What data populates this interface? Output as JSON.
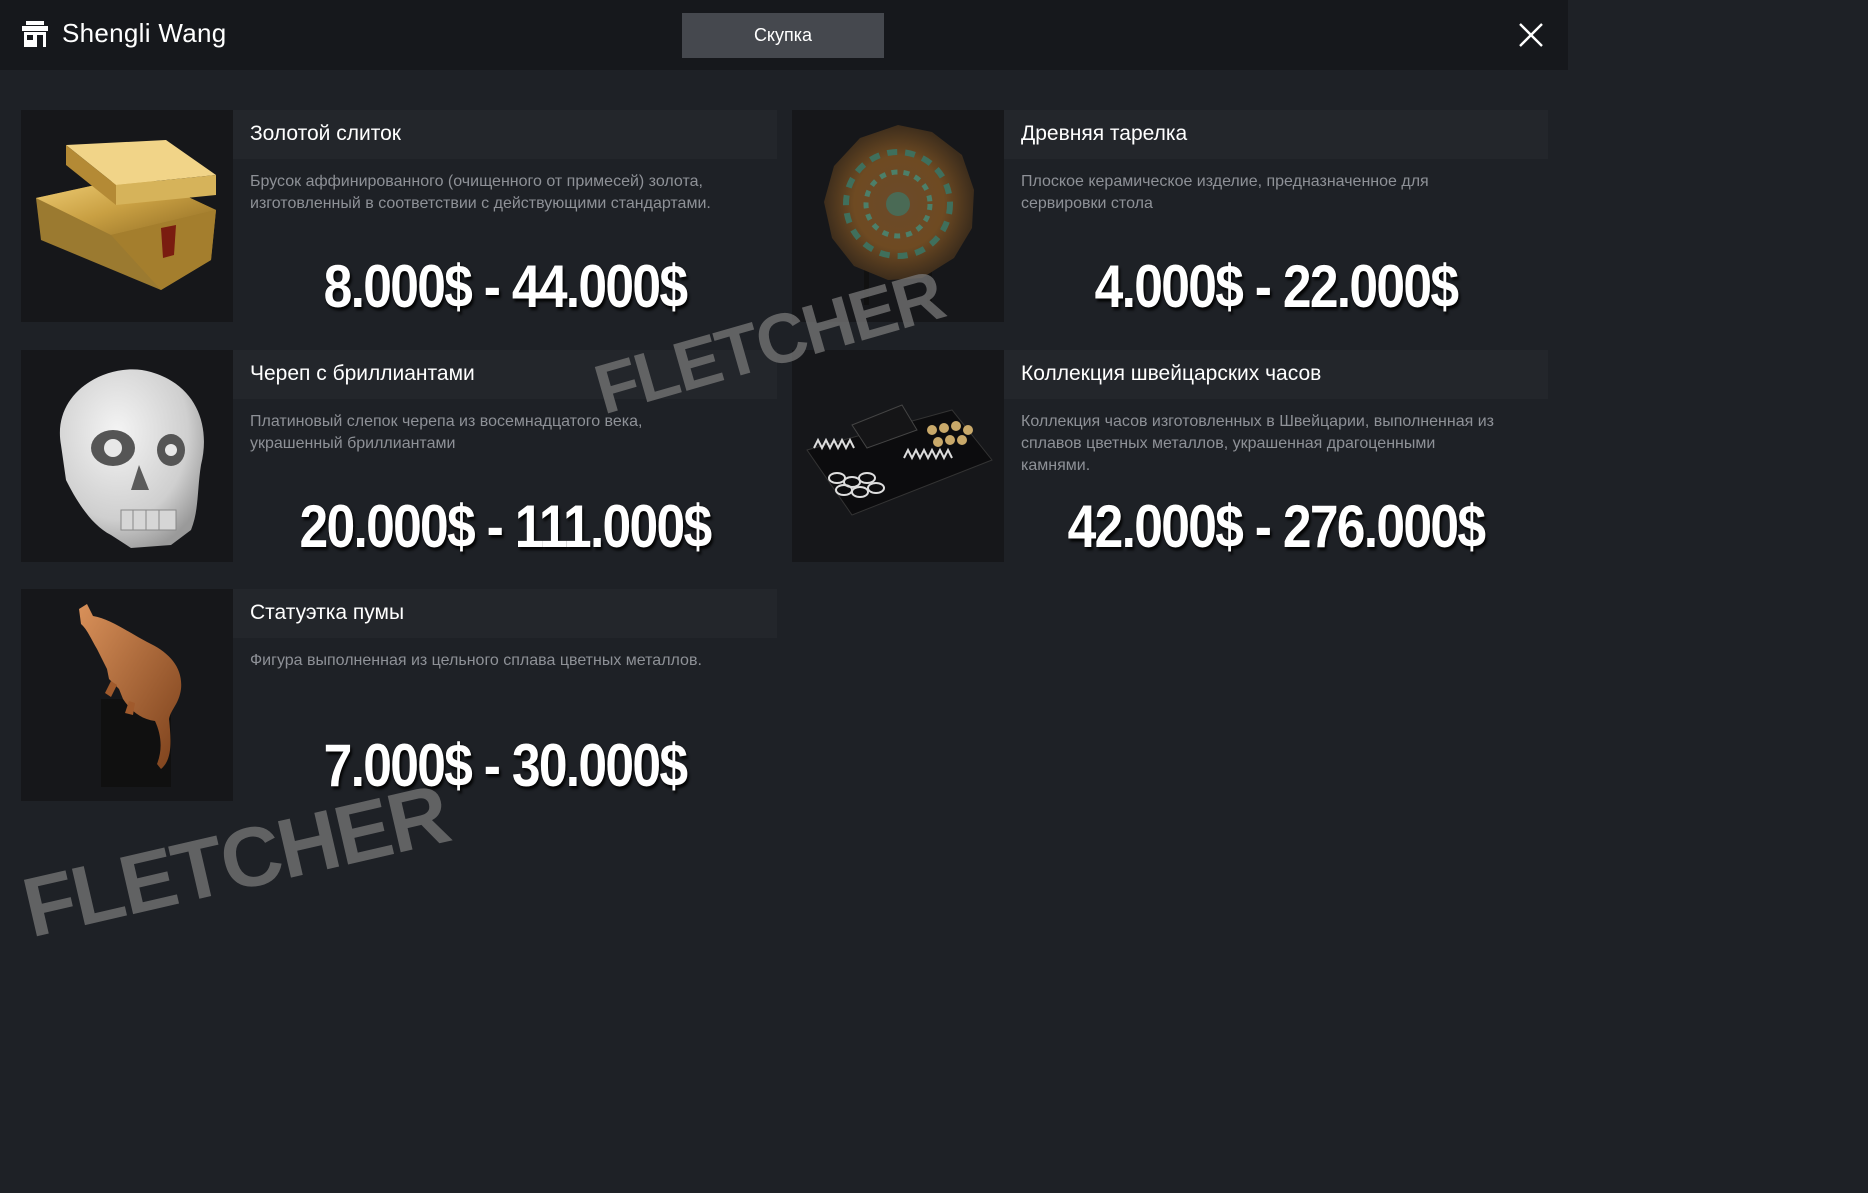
{
  "header": {
    "vendor_name": "Shengli Wang",
    "tab_label": "Скупка",
    "icons": {
      "shop": "shop-icon",
      "close": "close-icon"
    }
  },
  "items": [
    {
      "name": "Золотой слиток",
      "description": "Брусок аффинированного (очищенного от примесей) золота, изготовленный в соответствии с действующими стандартами.",
      "price_range": "8.000$ - 44.000$",
      "image": "gold-bar-image"
    },
    {
      "name": "Древняя тарелка",
      "description": "Плоское керамическое изделие, предназначенное для сервировки стола",
      "price_range": "4.000$ - 22.000$",
      "image": "ancient-plate-image"
    },
    {
      "name": "Череп с бриллиантами",
      "description": "Платиновый слепок черепа из восемнадцатого века, украшенный бриллиантами",
      "price_range": "20.000$ - 111.000$",
      "image": "diamond-skull-image"
    },
    {
      "name": "Коллекция швейцарских часов",
      "description": "Коллекция часов изготовленных в Швейцарии, выполненная из сплавов цветных металлов, украшенная драгоценными камнями.",
      "price_range": "42.000$ - 276.000$",
      "image": "watch-collection-image"
    },
    {
      "name": "Статуэтка пумы",
      "description": "Фигура выполненная из цельного сплава цветных металлов.",
      "price_range": "7.000$ - 30.000$",
      "image": "puma-statuette-image"
    }
  ],
  "watermarks": [
    "FLETCHER",
    "FLETCHER"
  ],
  "colors": {
    "background": "#1e2126",
    "topbar": "#16181c",
    "tab_active": "#45484e",
    "name_bar": "#23262b",
    "description_text": "#8e9197"
  }
}
